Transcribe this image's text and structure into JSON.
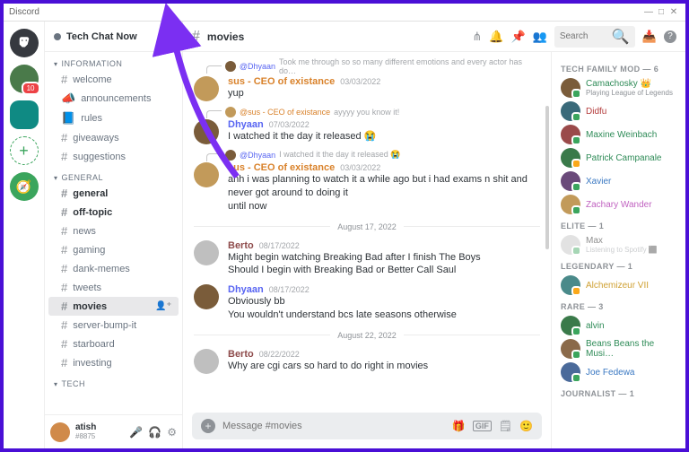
{
  "window": {
    "title": "Discord",
    "min": "—",
    "max": "□",
    "close": "✕"
  },
  "guilds": {
    "badge": "10"
  },
  "server": {
    "name": "Tech Chat Now"
  },
  "categories": [
    {
      "label": "INFORMATION",
      "channels": [
        {
          "name": "welcome",
          "icon": "hash"
        },
        {
          "name": "announcements",
          "icon": "mega"
        },
        {
          "name": "rules",
          "icon": "rules"
        },
        {
          "name": "giveaways",
          "icon": "hash"
        },
        {
          "name": "suggestions",
          "icon": "hash"
        }
      ]
    },
    {
      "label": "GENERAL",
      "channels": [
        {
          "name": "general",
          "icon": "hash",
          "bold": true
        },
        {
          "name": "off-topic",
          "icon": "hash",
          "bold": true
        },
        {
          "name": "news",
          "icon": "hash"
        },
        {
          "name": "gaming",
          "icon": "hash"
        },
        {
          "name": "dank-memes",
          "icon": "hash"
        },
        {
          "name": "tweets",
          "icon": "hash"
        },
        {
          "name": "movies",
          "icon": "hash",
          "sel": true
        },
        {
          "name": "server-bump-it",
          "icon": "hash"
        },
        {
          "name": "starboard",
          "icon": "hash"
        },
        {
          "name": "investing",
          "icon": "hash"
        }
      ]
    },
    {
      "label": "TECH",
      "channels": []
    }
  ],
  "user": {
    "name": "atish",
    "tag": "#8875"
  },
  "header": {
    "channel": "movies"
  },
  "search": {
    "placeholder": "Search"
  },
  "input": {
    "placeholder": "Message #movies"
  },
  "messages": {
    "r1": {
      "who": "Dhyaan",
      "text": "Took me through so so many different emotions and every actor has do…"
    },
    "m1": {
      "name": "sus - CEO of existance",
      "time": "03/03/2022",
      "text": "yup"
    },
    "r2": {
      "who": "sus - CEO of existance",
      "text": "ayyyy you know it!"
    },
    "m2": {
      "name": "Dhyaan",
      "time": "07/03/2022",
      "text": "I watched it the day it released 😭"
    },
    "r3": {
      "who": "Dhyaan",
      "text": "I watched it the day it released 😭"
    },
    "m3": {
      "name": "sus - CEO of existance",
      "time": "03/03/2022",
      "text": "ahh i was planning to watch it a while ago but i had exams n shit and never got around to doing it",
      "text2": "until now"
    },
    "d1": "August 17, 2022",
    "m4": {
      "name": "Berto",
      "time": "08/17/2022",
      "text": "Might begin watching Breaking Bad after I finish The Boys",
      "text2": "Should I begin with Breaking Bad or Better Call Saul"
    },
    "m5": {
      "name": "Dhyaan",
      "time": "08/17/2022",
      "text": "Obviously bb",
      "text2": "You wouldn't understand bcs late seasons otherwise"
    },
    "d2": "August 22, 2022",
    "m6": {
      "name": "Berto",
      "time": "08/22/2022",
      "text": "Why are cgi cars so hard to do right in movies"
    }
  },
  "memberGroups": [
    {
      "label": "TECH FAMILY MOD — 6",
      "members": [
        {
          "name": "Camachosky",
          "cls": "c-grn",
          "ava": "av-a",
          "crown": true,
          "sub": "Playing League of Legends"
        },
        {
          "name": "Didfu",
          "cls": "c-red",
          "ava": "av-b"
        },
        {
          "name": "Maxine Weinbach",
          "cls": "c-grn",
          "ava": "av-c"
        },
        {
          "name": "Patrick Campanale",
          "cls": "c-grn",
          "ava": "av-e",
          "idle": true
        },
        {
          "name": "Xavier",
          "cls": "c-blu",
          "ava": "av-f"
        },
        {
          "name": "Zachary Wander",
          "cls": "c-pnk",
          "ava": "av-g"
        }
      ]
    },
    {
      "label": "ELITE — 1",
      "members": [
        {
          "name": "Max",
          "cls": "",
          "ava": "av-d",
          "sub": "Listening to Spotify ⬛",
          "faded": true
        }
      ]
    },
    {
      "label": "LEGENDARY — 1",
      "members": [
        {
          "name": "Alchemizeur VII",
          "cls": "c-gold",
          "ava": "av-h",
          "idle": true
        }
      ]
    },
    {
      "label": "RARE — 3",
      "members": [
        {
          "name": "alvin",
          "cls": "c-grn",
          "ava": "av-e"
        },
        {
          "name": "Beans Beans the Musi…",
          "cls": "c-grn",
          "ava": "av-i"
        },
        {
          "name": "Joe Fedewa",
          "cls": "c-blu",
          "ava": "av-j"
        }
      ]
    },
    {
      "label": "JOURNALIST — 1",
      "members": []
    }
  ],
  "icons": {
    "gift": "🎁",
    "gif": "GIF",
    "sticker": "🗒",
    "emoji": "🙂",
    "thread": "⋔",
    "bell": "🔔",
    "pin": "📌",
    "users": "👥",
    "inbox": "📥",
    "help": "?"
  }
}
